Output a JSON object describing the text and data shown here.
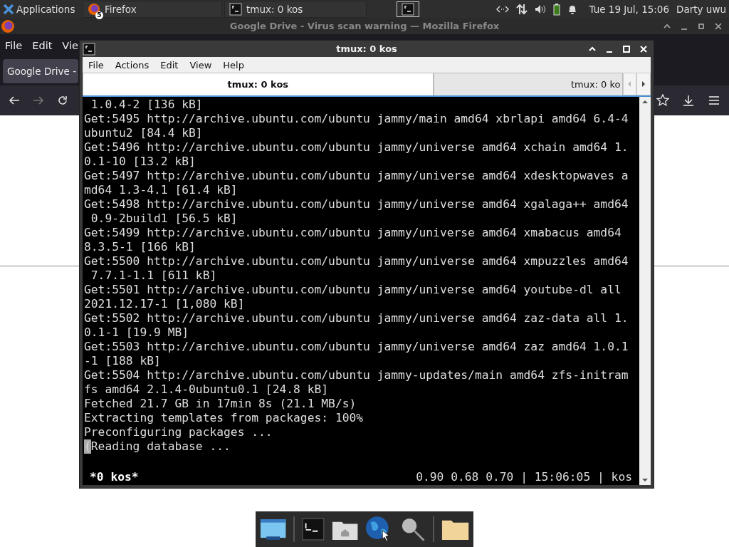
{
  "top_panel": {
    "apps_menu": "Applications",
    "tasks": [
      {
        "kind": "firefox",
        "label": "Firefox",
        "badge": "5"
      },
      {
        "kind": "terminal",
        "label": "tmux: 0 kos"
      }
    ],
    "clock": "Tue 19 Jul, 15:06",
    "user": "Darty uwu"
  },
  "firefox": {
    "title": "Google Drive - Virus scan warning — Mozilla Firefox",
    "menu": [
      "File",
      "Edit",
      "Vie"
    ],
    "tab": "Google Drive -"
  },
  "terminal": {
    "title": "tmux: 0 kos",
    "menu": [
      "File",
      "Actions",
      "Edit",
      "View",
      "Help"
    ],
    "tabs": [
      {
        "label": "tmux: 0 kos",
        "selected": true
      },
      {
        "label": "tmux: 0 ko",
        "selected": false
      }
    ],
    "lines": [
      " 1.0.4-2 [136 kB]",
      "Get:5495 http://archive.ubuntu.com/ubuntu jammy/main amd64 xbrlapi amd64 6.4-4",
      "ubuntu2 [84.4 kB]",
      "Get:5496 http://archive.ubuntu.com/ubuntu jammy/universe amd64 xchain amd64 1.",
      "0.1-10 [13.2 kB]",
      "Get:5497 http://archive.ubuntu.com/ubuntu jammy/universe amd64 xdesktopwaves a",
      "md64 1.3-4.1 [61.4 kB]",
      "Get:5498 http://archive.ubuntu.com/ubuntu jammy/universe amd64 xgalaga++ amd64",
      " 0.9-2build1 [56.5 kB]",
      "Get:5499 http://archive.ubuntu.com/ubuntu jammy/universe amd64 xmabacus amd64",
      "8.3.5-1 [166 kB]",
      "Get:5500 http://archive.ubuntu.com/ubuntu jammy/universe amd64 xmpuzzles amd64",
      " 7.7.1-1.1 [611 kB]",
      "Get:5501 http://archive.ubuntu.com/ubuntu jammy/universe amd64 youtube-dl all",
      "2021.12.17-1 [1,080 kB]",
      "Get:5502 http://archive.ubuntu.com/ubuntu jammy/universe amd64 zaz-data all 1.",
      "0.1-1 [19.9 MB]",
      "Get:5503 http://archive.ubuntu.com/ubuntu jammy/universe amd64 zaz amd64 1.0.1",
      "-1 [188 kB]",
      "Get:5504 http://archive.ubuntu.com/ubuntu jammy-updates/main amd64 zfs-initram",
      "fs amd64 2.1.4-0ubuntu0.1 [24.8 kB]",
      "Fetched 21.7 GB in 17min 8s (21.1 MB/s)",
      "Extracting templates from packages: 100%",
      "Preconfiguring packages ..."
    ],
    "prompt": {
      "text": "(Reading database ...",
      "cursor": true
    },
    "status_left": "*0 kos*",
    "status_right": "0.90 0.68 0.70 | 15:06:05 | kos"
  }
}
